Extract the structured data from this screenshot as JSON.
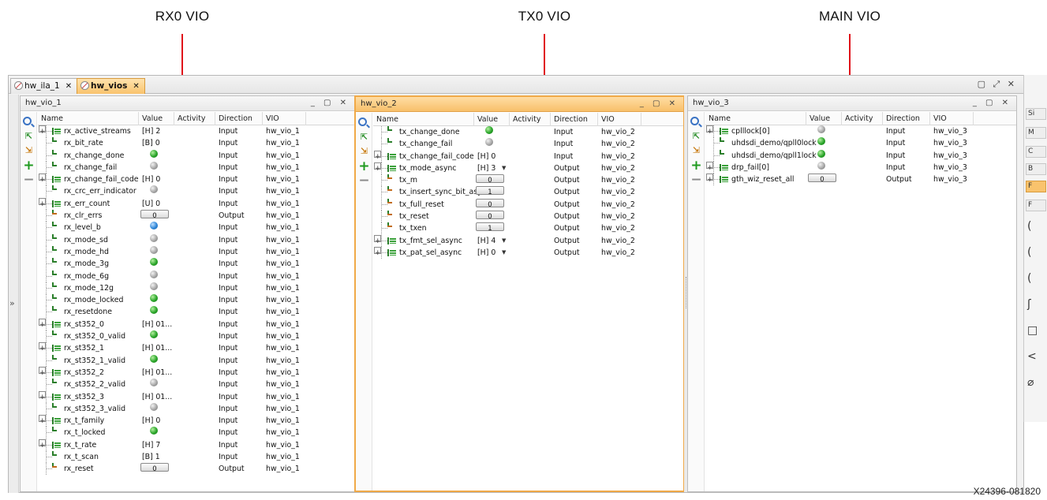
{
  "callouts": {
    "rx": "RX0 VIO",
    "tx": "TX0 VIO",
    "main": "MAIN VIO"
  },
  "figure_id": "X24396-081820",
  "tabs": [
    {
      "label": "hw_ila_1",
      "active": false
    },
    {
      "label": "hw_vios",
      "active": true
    }
  ],
  "columns": {
    "name": "Name",
    "value": "Value",
    "activity": "Activity",
    "direction": "Direction",
    "vio": "VIO"
  },
  "colors": {
    "accent": "#f9c36d",
    "led_green": "#2aa52a",
    "led_gray": "#a7a7a7",
    "led_blue": "#2f87d8"
  },
  "panels": [
    {
      "title": "hw_vio_1",
      "rows": [
        {
          "name": "rx_active_streams",
          "kind": "bus",
          "value": "[H] 2",
          "dir": "Input",
          "vio": "hw_vio_1"
        },
        {
          "name": "rx_bit_rate",
          "kind": "single",
          "value": "[B] 0",
          "dir": "Input",
          "vio": "hw_vio_1"
        },
        {
          "name": "rx_change_done",
          "kind": "single",
          "led": "green",
          "dir": "Input",
          "vio": "hw_vio_1"
        },
        {
          "name": "rx_change_fail",
          "kind": "single",
          "led": "gray",
          "dir": "Input",
          "vio": "hw_vio_1"
        },
        {
          "name": "rx_change_fail_code",
          "kind": "bus",
          "value": "[H] 0",
          "dir": "Input",
          "vio": "hw_vio_1"
        },
        {
          "name": "rx_crc_err_indicator",
          "kind": "single",
          "led": "gray",
          "dir": "Input",
          "vio": "hw_vio_1"
        },
        {
          "name": "rx_err_count",
          "kind": "bus",
          "value": "[U] 0",
          "dir": "Input",
          "vio": "hw_vio_1"
        },
        {
          "name": "rx_clr_errs",
          "kind": "out",
          "button": "0",
          "dir": "Output",
          "vio": "hw_vio_1"
        },
        {
          "name": "rx_level_b",
          "kind": "single",
          "led": "blue",
          "dir": "Input",
          "vio": "hw_vio_1"
        },
        {
          "name": "rx_mode_sd",
          "kind": "single",
          "led": "gray",
          "dir": "Input",
          "vio": "hw_vio_1"
        },
        {
          "name": "rx_mode_hd",
          "kind": "single",
          "led": "gray",
          "dir": "Input",
          "vio": "hw_vio_1"
        },
        {
          "name": "rx_mode_3g",
          "kind": "single",
          "led": "green",
          "dir": "Input",
          "vio": "hw_vio_1"
        },
        {
          "name": "rx_mode_6g",
          "kind": "single",
          "led": "gray",
          "dir": "Input",
          "vio": "hw_vio_1"
        },
        {
          "name": "rx_mode_12g",
          "kind": "single",
          "led": "gray",
          "dir": "Input",
          "vio": "hw_vio_1"
        },
        {
          "name": "rx_mode_locked",
          "kind": "single",
          "led": "green",
          "dir": "Input",
          "vio": "hw_vio_1"
        },
        {
          "name": "rx_resetdone",
          "kind": "single",
          "led": "green",
          "dir": "Input",
          "vio": "hw_vio_1"
        },
        {
          "name": "rx_st352_0",
          "kind": "bus",
          "value": "[H] 01...",
          "dir": "Input",
          "vio": "hw_vio_1"
        },
        {
          "name": "rx_st352_0_valid",
          "kind": "single",
          "led": "green",
          "dir": "Input",
          "vio": "hw_vio_1"
        },
        {
          "name": "rx_st352_1",
          "kind": "bus",
          "value": "[H] 01...",
          "dir": "Input",
          "vio": "hw_vio_1"
        },
        {
          "name": "rx_st352_1_valid",
          "kind": "single",
          "led": "green",
          "dir": "Input",
          "vio": "hw_vio_1"
        },
        {
          "name": "rx_st352_2",
          "kind": "bus",
          "value": "[H] 01...",
          "dir": "Input",
          "vio": "hw_vio_1"
        },
        {
          "name": "rx_st352_2_valid",
          "kind": "single",
          "led": "gray",
          "dir": "Input",
          "vio": "hw_vio_1"
        },
        {
          "name": "rx_st352_3",
          "kind": "bus",
          "value": "[H] 01...",
          "dir": "Input",
          "vio": "hw_vio_1"
        },
        {
          "name": "rx_st352_3_valid",
          "kind": "single",
          "led": "gray",
          "dir": "Input",
          "vio": "hw_vio_1"
        },
        {
          "name": "rx_t_family",
          "kind": "bus",
          "value": "[H] 0",
          "dir": "Input",
          "vio": "hw_vio_1"
        },
        {
          "name": "rx_t_locked",
          "kind": "single",
          "led": "green",
          "dir": "Input",
          "vio": "hw_vio_1"
        },
        {
          "name": "rx_t_rate",
          "kind": "bus",
          "value": "[H] 7",
          "dir": "Input",
          "vio": "hw_vio_1"
        },
        {
          "name": "rx_t_scan",
          "kind": "single",
          "value": "[B] 1",
          "dir": "Input",
          "vio": "hw_vio_1"
        },
        {
          "name": "rx_reset",
          "kind": "out",
          "button": "0",
          "dir": "Output",
          "vio": "hw_vio_1"
        }
      ]
    },
    {
      "title": "hw_vio_2",
      "rows": [
        {
          "name": "tx_change_done",
          "kind": "single",
          "led": "green",
          "dir": "Input",
          "vio": "hw_vio_2"
        },
        {
          "name": "tx_change_fail",
          "kind": "single",
          "led": "gray",
          "dir": "Input",
          "vio": "hw_vio_2"
        },
        {
          "name": "tx_change_fail_code",
          "kind": "bus",
          "value": "[H] 0",
          "dir": "Input",
          "vio": "hw_vio_2"
        },
        {
          "name": "tx_mode_async",
          "kind": "busout",
          "value": "[H] 3",
          "dropdown": true,
          "dir": "Output",
          "vio": "hw_vio_2"
        },
        {
          "name": "tx_m",
          "kind": "out",
          "button": "0",
          "dir": "Output",
          "vio": "hw_vio_2"
        },
        {
          "name": "tx_insert_sync_bit_async",
          "kind": "out",
          "button": "1",
          "dir": "Output",
          "vio": "hw_vio_2"
        },
        {
          "name": "tx_full_reset",
          "kind": "out",
          "button": "0",
          "dir": "Output",
          "vio": "hw_vio_2"
        },
        {
          "name": "tx_reset",
          "kind": "out",
          "button": "0",
          "dir": "Output",
          "vio": "hw_vio_2"
        },
        {
          "name": "tx_txen",
          "kind": "out",
          "button": "1",
          "dir": "Output",
          "vio": "hw_vio_2"
        },
        {
          "name": "tx_fmt_sel_async",
          "kind": "busout",
          "value": "[H] 4",
          "dropdown": true,
          "dir": "Output",
          "vio": "hw_vio_2"
        },
        {
          "name": "tx_pat_sel_async",
          "kind": "busout",
          "value": "[H] 0",
          "dropdown": true,
          "dir": "Output",
          "vio": "hw_vio_2"
        }
      ]
    },
    {
      "title": "hw_vio_3",
      "rows": [
        {
          "name": "cplllock[0]",
          "kind": "bus",
          "led": "gray",
          "dir": "Input",
          "vio": "hw_vio_3"
        },
        {
          "name": "uhdsdi_demo/qpll0lock",
          "kind": "single",
          "led": "green",
          "dir": "Input",
          "vio": "hw_vio_3"
        },
        {
          "name": "uhdsdi_demo/qpll1lock",
          "kind": "single",
          "led": "green",
          "dir": "Input",
          "vio": "hw_vio_3"
        },
        {
          "name": "drp_fail[0]",
          "kind": "bus",
          "led": "gray",
          "dir": "Input",
          "vio": "hw_vio_3"
        },
        {
          "name": "gth_wiz_reset_all",
          "kind": "busout",
          "button": "0",
          "dir": "Output",
          "vio": "hw_vio_3"
        }
      ]
    }
  ],
  "right_edge": [
    "Si",
    "M",
    "C",
    "B",
    "F",
    "F"
  ]
}
